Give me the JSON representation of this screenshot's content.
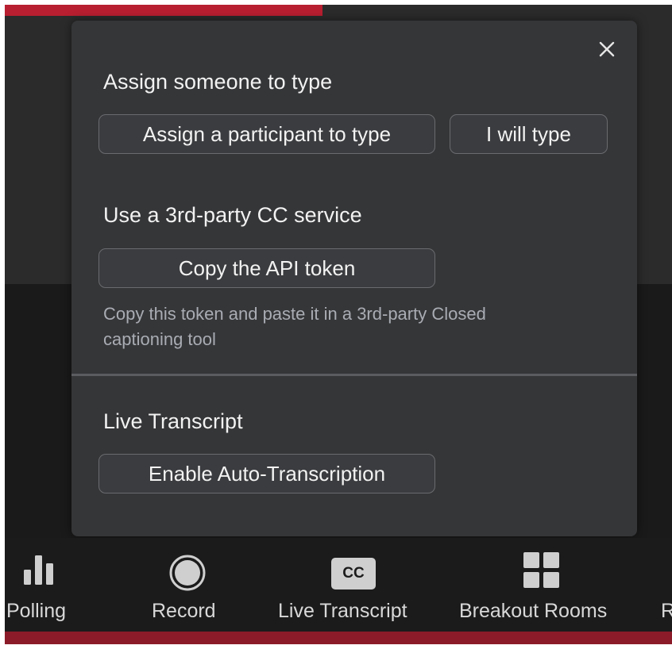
{
  "popup": {
    "close_icon": "close-icon",
    "assign_section": {
      "title": "Assign someone to type",
      "assign_participant_label": "Assign a participant to type",
      "self_type_label": "I will type"
    },
    "third_party_section": {
      "title": "Use a 3rd-party CC service",
      "copy_token_label": "Copy the API token",
      "hint_line1": "Copy this token and paste it in a 3rd-party Closed",
      "hint_line2": "captioning tool"
    },
    "live_transcript_section": {
      "title": "Live Transcript",
      "enable_label": "Enable Auto-Transcription"
    }
  },
  "toolbar": {
    "items": [
      {
        "label": "Polling",
        "icon": "bar-chart-icon"
      },
      {
        "label": "Record",
        "icon": "record-icon"
      },
      {
        "label": "Live Transcript",
        "icon": "cc-icon",
        "icon_text": "CC"
      },
      {
        "label": "Breakout Rooms",
        "icon": "grid-icon"
      },
      {
        "label": "R"
      }
    ]
  },
  "colors": {
    "popup_bg": "#353638",
    "button_border": "#6a6b6e",
    "hint_text": "#a9acb3",
    "accent_red": "#b81f30"
  }
}
